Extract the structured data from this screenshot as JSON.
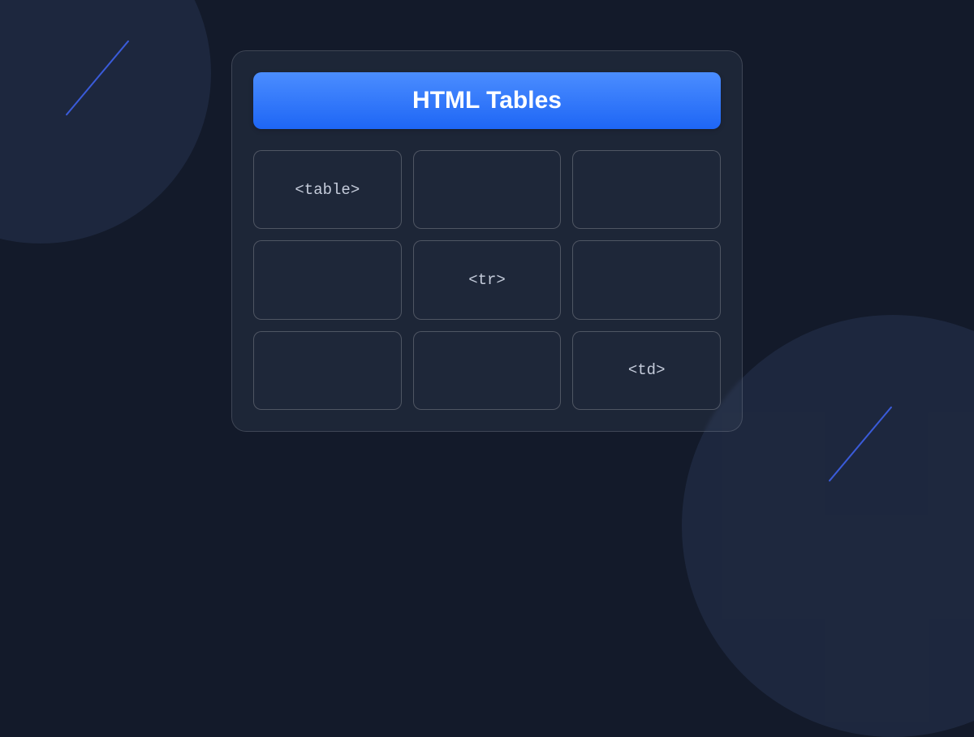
{
  "title": "HTML Tables",
  "grid": {
    "rows": [
      [
        "<table>",
        "",
        ""
      ],
      [
        "",
        "<tr>",
        ""
      ],
      [
        "",
        "",
        "<td>"
      ]
    ]
  }
}
